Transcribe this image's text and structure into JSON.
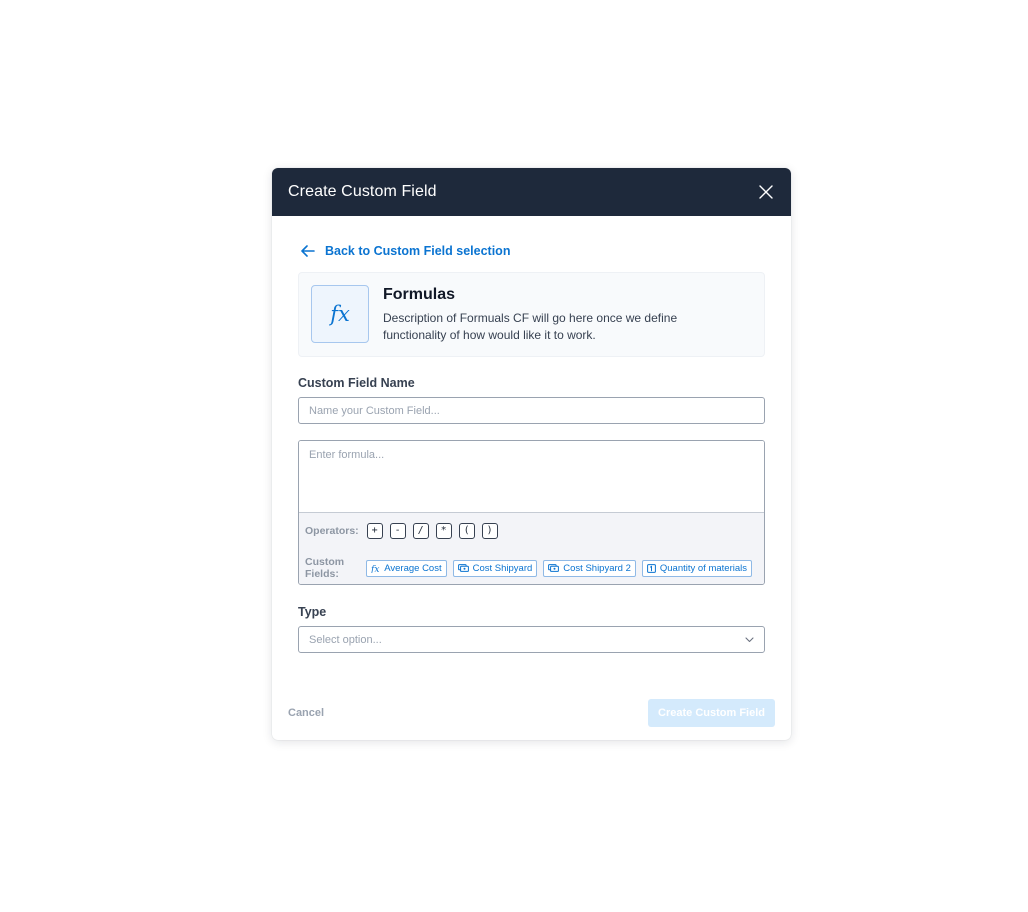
{
  "modal": {
    "title": "Create Custom Field"
  },
  "back_link": {
    "label": "Back to Custom Field selection"
  },
  "info_card": {
    "icon": "fx",
    "title": "Formulas",
    "description": "Description of Formuals CF will go here once we define functionality of how would like it to work."
  },
  "name_field": {
    "label": "Custom Field Name",
    "value": "",
    "placeholder": "Name your Custom Field..."
  },
  "formula": {
    "value": "",
    "placeholder": "Enter formula...",
    "operators_label": "Operators:",
    "operators": [
      "+",
      "-",
      "/",
      "*",
      "(",
      ")"
    ],
    "custom_fields_label": "Custom Fields:",
    "custom_fields": [
      {
        "label": "Average Cost",
        "icon": "fx-icon"
      },
      {
        "label": "Cost Shipyard",
        "icon": "currency-icon"
      },
      {
        "label": "Cost Shipyard 2",
        "icon": "currency-icon"
      },
      {
        "label": "Quantity of materials",
        "icon": "number-icon"
      }
    ]
  },
  "type_field": {
    "label": "Type",
    "placeholder": "Select option..."
  },
  "footer": {
    "cancel_label": "Cancel",
    "create_label": "Create Custom Field"
  },
  "colors": {
    "header_bg": "#1e293b",
    "accent": "#0b74d1",
    "disabled_button": "#d4eafc"
  }
}
